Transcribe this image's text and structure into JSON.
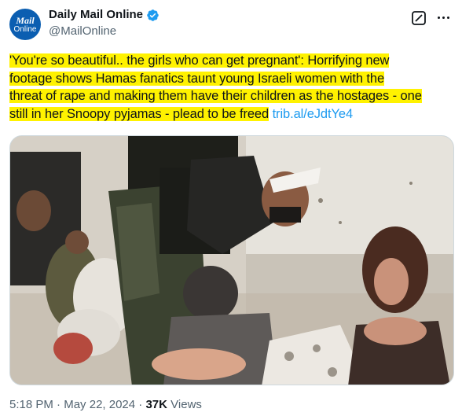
{
  "author": {
    "display_name": "Daily Mail Online",
    "handle": "@MailOnline",
    "avatar_line1": "Mail",
    "avatar_line2": "Online",
    "verified_icon": "verified-badge-icon",
    "verified_color": "#1d9bf0"
  },
  "post": {
    "text_lines": [
      "'You're so beautiful.. the girls who can get pregnant': Horrifying new",
      "footage shows Hamas fanatics taunt young Israeli women with the",
      "threat of rape and making them have their children as the hostages - one",
      "still in her Snoopy pyjamas - plead to be freed"
    ],
    "link": "trib.al/eJdtYe4",
    "highlight_color": "#fff200"
  },
  "media": {
    "kind": "video still"
  },
  "footer": {
    "time": "5:18 PM",
    "sep1": " · ",
    "date": "May 22, 2024",
    "sep2": " · ",
    "views_count": "37K",
    "views_label": " Views"
  },
  "icons": {
    "grok": "grok-icon",
    "more": "more-icon"
  }
}
